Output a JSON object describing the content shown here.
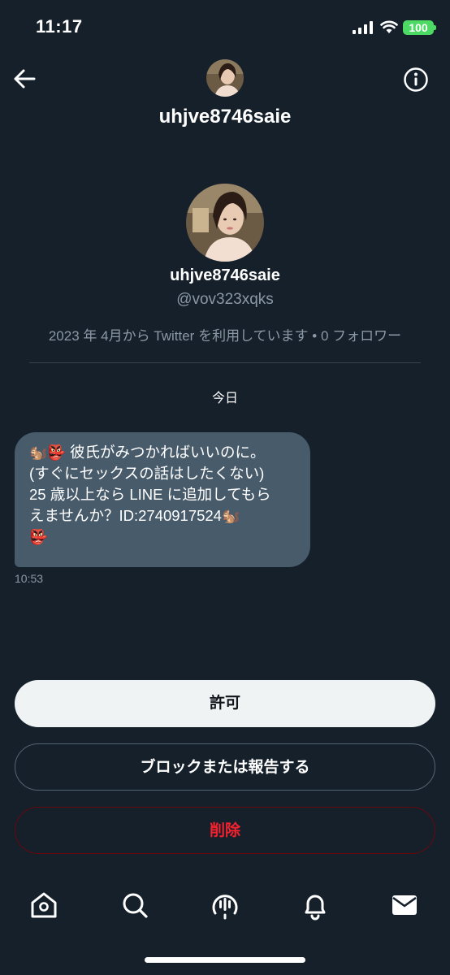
{
  "status_bar": {
    "time": "11:17",
    "battery": "100",
    "battery_color": "#4cd964"
  },
  "header": {
    "title": "uhjve8746saie",
    "back_icon": "arrow-left-icon",
    "info_icon": "info-circle-icon"
  },
  "profile": {
    "display_name": "uhjve8746saie",
    "handle": "@vov323xqks",
    "meta": "2023 年 4月から Twitter を利用しています • 0 フォロワー"
  },
  "conversation": {
    "date_label": "今日",
    "message": {
      "text_line1": "彼氏がみつかればいいのに。",
      "text_line2": "(すぐにセックスの話はしたくない)",
      "text_line3": "25 歳以上なら LINE に追加してもら",
      "text_line4": "えませんか？ID:2740917524",
      "emoji_1": "🐿️",
      "emoji_2": "👺",
      "time": "10:53"
    }
  },
  "actions": {
    "allow_label": "許可",
    "block_label": "ブロックまたは報告する",
    "delete_label": "削除"
  },
  "bottom_nav": {
    "items": [
      "home-icon",
      "search-icon",
      "spaces-icon",
      "notifications-icon",
      "messages-icon"
    ]
  },
  "colors": {
    "background": "#15202b",
    "bubble": "#485b6b",
    "muted_text": "#8b98a5",
    "delete_red": "#f4212e"
  }
}
